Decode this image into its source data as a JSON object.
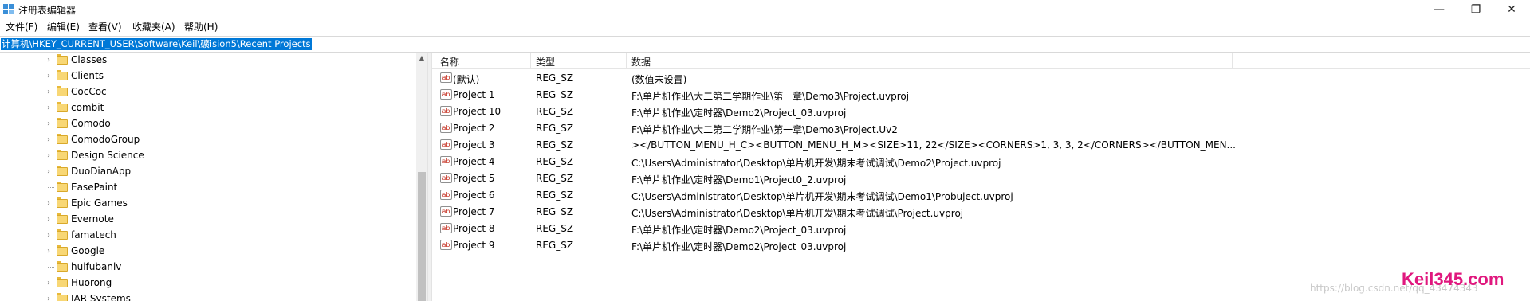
{
  "window": {
    "title": "注册表编辑器",
    "controls": {
      "minimize": "—",
      "maximize": "❐",
      "close": "✕"
    }
  },
  "menu": [
    "文件(F)",
    "编辑(E)",
    "查看(V)",
    "收藏夹(A)",
    "帮助(H)"
  ],
  "address": "计算机\\HKEY_CURRENT_USER\\Software\\Keil\\礦ision5\\Recent Projects",
  "tree": {
    "items": [
      {
        "label": "Classes",
        "expandable": true
      },
      {
        "label": "Clients",
        "expandable": true
      },
      {
        "label": "CocCoc",
        "expandable": true
      },
      {
        "label": "combit",
        "expandable": true
      },
      {
        "label": "Comodo",
        "expandable": true
      },
      {
        "label": "ComodoGroup",
        "expandable": true
      },
      {
        "label": "Design Science",
        "expandable": true
      },
      {
        "label": "DuoDianApp",
        "expandable": true
      },
      {
        "label": "EasePaint",
        "expandable": false
      },
      {
        "label": "Epic Games",
        "expandable": true
      },
      {
        "label": "Evernote",
        "expandable": true
      },
      {
        "label": "famatech",
        "expandable": true
      },
      {
        "label": "Google",
        "expandable": true
      },
      {
        "label": "huifubanlv",
        "expandable": false
      },
      {
        "label": "Huorong",
        "expandable": true
      },
      {
        "label": "IAR Systems",
        "expandable": true
      }
    ]
  },
  "list": {
    "headers": {
      "name": "名称",
      "type": "类型",
      "data": "数据"
    },
    "rows": [
      {
        "name": "(默认)",
        "type": "REG_SZ",
        "data": "(数值未设置)"
      },
      {
        "name": "Project 1",
        "type": "REG_SZ",
        "data": "F:\\单片机作业\\大二第二学期作业\\第一章\\Demo3\\Project.uvproj"
      },
      {
        "name": "Project 10",
        "type": "REG_SZ",
        "data": "F:\\单片机作业\\定时器\\Demo2\\Project_03.uvproj"
      },
      {
        "name": "Project 2",
        "type": "REG_SZ",
        "data": "F:\\单片机作业\\大二第二学期作业\\第一章\\Demo3\\Project.Uv2"
      },
      {
        "name": "Project 3",
        "type": "REG_SZ",
        "data": "></BUTTON_MENU_H_C><BUTTON_MENU_H_M><SIZE>11, 22</SIZE><CORNERS>1, 3, 3, 2</CORNERS></BUTTON_MEN..."
      },
      {
        "name": "Project 4",
        "type": "REG_SZ",
        "data": "C:\\Users\\Administrator\\Desktop\\单片机开发\\期末考试调试\\Demo2\\Project.uvproj"
      },
      {
        "name": "Project 5",
        "type": "REG_SZ",
        "data": "F:\\单片机作业\\定时器\\Demo1\\Project0_2.uvproj"
      },
      {
        "name": "Project 6",
        "type": "REG_SZ",
        "data": "C:\\Users\\Administrator\\Desktop\\单片机开发\\期末考试调试\\Demo1\\Probuject.uvproj"
      },
      {
        "name": "Project 7",
        "type": "REG_SZ",
        "data": "C:\\Users\\Administrator\\Desktop\\单片机开发\\期末考试调试\\Project.uvproj"
      },
      {
        "name": "Project 8",
        "type": "REG_SZ",
        "data": "F:\\单片机作业\\定时器\\Demo2\\Project_03.uvproj"
      },
      {
        "name": "Project 9",
        "type": "REG_SZ",
        "data": "F:\\单片机作业\\定时器\\Demo2\\Project_03.uvproj"
      }
    ],
    "value_icon_text": "ab"
  },
  "overlay": {
    "watermark": "https://blog.csdn.net/qq_43474343",
    "brand": "Keil345.com"
  },
  "colors": {
    "selection": "#0078d7",
    "folder": "#f8d775",
    "brand": "#e0187e"
  }
}
